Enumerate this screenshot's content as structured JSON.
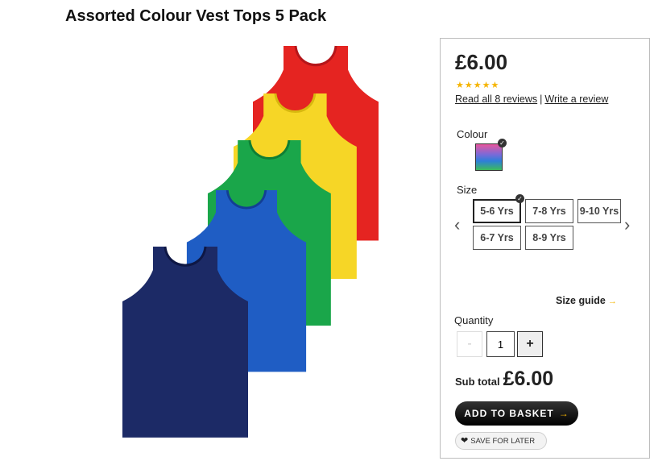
{
  "product": {
    "title": "Assorted Colour Vest Tops 5 Pack"
  },
  "purchase": {
    "price": "£6.00",
    "rating_stars": "★★★★★",
    "reviews_link": "Read all 8 reviews",
    "review_separator": "|",
    "write_review_link": "Write a review",
    "colour_label": "Colour",
    "size_label": "Size",
    "sizes": [
      "5-6 Yrs",
      "7-8 Yrs",
      "9-10 Yrs",
      "6-7 Yrs",
      "8-9 Yrs"
    ],
    "selected_size": "5-6 Yrs",
    "size_guide": "Size guide",
    "quantity_label": "Quantity",
    "quantity_minus": "-",
    "quantity_value": "1",
    "quantity_plus": "+",
    "subtotal_label": "Sub total",
    "subtotal_value": "£6.00",
    "add_to_basket": "ADD TO BASKET",
    "save_for_later": "SAVE FOR LATER"
  },
  "icons": {
    "check": "✓",
    "arrow_left": "‹",
    "arrow_right": "›",
    "chevron": "→",
    "heart": "❤"
  },
  "colors": {
    "star": "#f5b400",
    "vests": [
      "#e52421",
      "#f6d626",
      "#1aa64a",
      "#1f5dc4",
      "#1c2a66"
    ]
  }
}
